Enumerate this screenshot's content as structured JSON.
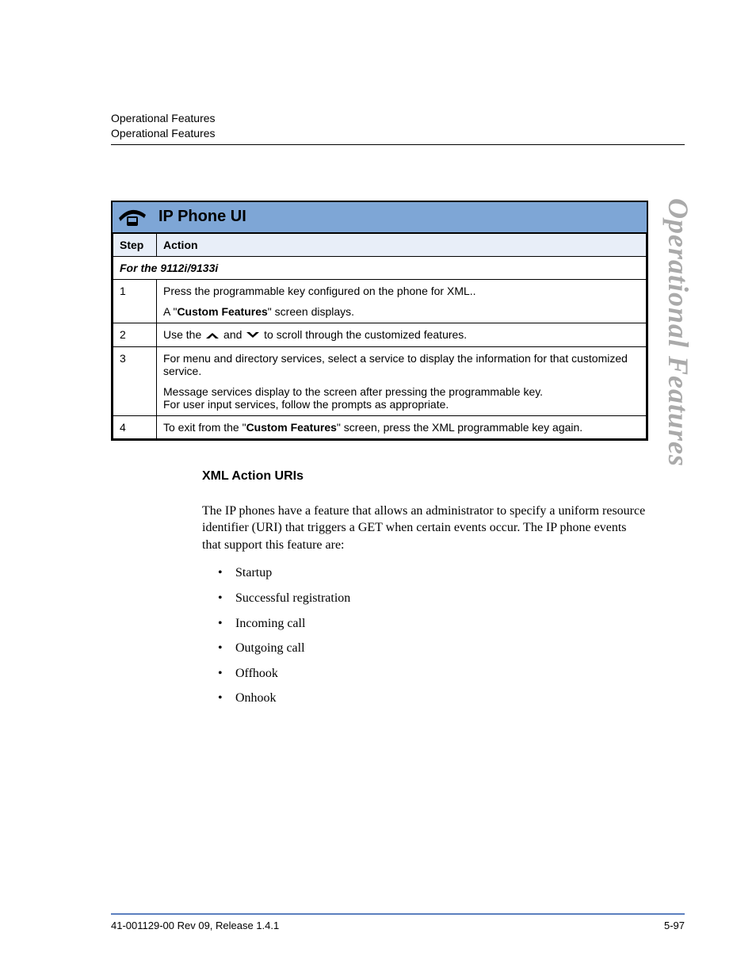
{
  "header": {
    "line1": "Operational Features",
    "line2": "Operational Features"
  },
  "side_tab": "Operational Features",
  "ipbox": {
    "title": "IP Phone UI",
    "col_step": "Step",
    "col_action": "Action",
    "subheader": "For the 9112i/9133i",
    "rows": [
      {
        "step": "1",
        "action_line1": "Press the programmable key configured on the phone for XML..",
        "action_line2a": "A \"",
        "action_line2_bold": "Custom Features",
        "action_line2b": "\" screen displays."
      },
      {
        "step": "2",
        "action_pre": "Use the ",
        "action_mid": " and ",
        "action_post": " to scroll through the customized features."
      },
      {
        "step": "3",
        "action_p1": "For menu and directory services, select a service to display the information for that customized service.",
        "action_p2": "Message services display to the screen after pressing the programmable key.",
        "action_p3": "For user input services, follow the prompts as appropriate."
      },
      {
        "step": "4",
        "action_pre": "To exit from the \"",
        "action_bold": "Custom Features",
        "action_post": "\" screen, press the XML programmable key again."
      }
    ]
  },
  "subsection": {
    "title": "XML Action URIs",
    "paragraph": "The IP phones have a feature that allows an administrator to specify a uniform resource identifier (URI) that triggers a GET when certain events occur. The IP phone events that support this feature are:",
    "bullets": [
      "Startup",
      "Successful registration",
      "Incoming call",
      "Outgoing call",
      "Offhook",
      "Onhook"
    ]
  },
  "footer": {
    "left": "41-001129-00 Rev 09, Release 1.4.1",
    "right": "5-97"
  }
}
